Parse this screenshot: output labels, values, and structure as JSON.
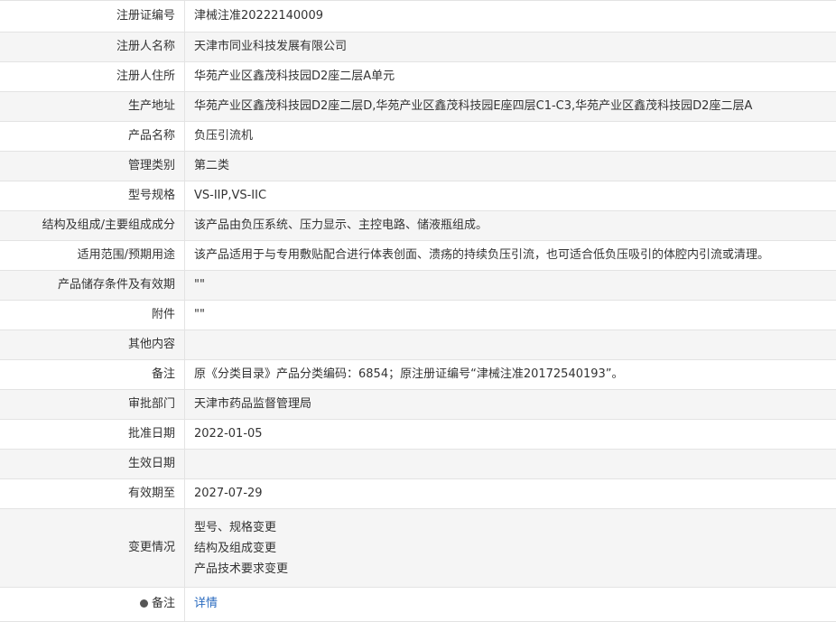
{
  "rows": [
    {
      "label": "注册证编号",
      "value": "津械注准20222140009"
    },
    {
      "label": "注册人名称",
      "value": "天津市同业科技发展有限公司"
    },
    {
      "label": "注册人住所",
      "value": "华苑产业区鑫茂科技园D2座二层A单元"
    },
    {
      "label": "生产地址",
      "value": "华苑产业区鑫茂科技园D2座二层D,华苑产业区鑫茂科技园E座四层C1-C3,华苑产业区鑫茂科技园D2座二层A"
    },
    {
      "label": "产品名称",
      "value": "负压引流机"
    },
    {
      "label": "管理类别",
      "value": "第二类"
    },
    {
      "label": "型号规格",
      "value": "VS-IIP,VS-IIC"
    },
    {
      "label": "结构及组成/主要组成成分",
      "value": "该产品由负压系统、压力显示、主控电路、储液瓶组成。"
    },
    {
      "label": "适用范围/预期用途",
      "value": "该产品适用于与专用敷贴配合进行体表创面、溃疡的持续负压引流，也可适合低负压吸引的体腔内引流或清理。"
    },
    {
      "label": "产品储存条件及有效期",
      "value": "\"\""
    },
    {
      "label": "附件",
      "value": "\"\""
    },
    {
      "label": "其他内容",
      "value": ""
    },
    {
      "label": "备注",
      "value": "原《分类目录》产品分类编码：6854；原注册证编号“津械注准20172540193”。"
    },
    {
      "label": "审批部门",
      "value": "天津市药品监督管理局"
    },
    {
      "label": "批准日期",
      "value": "2022-01-05"
    },
    {
      "label": "生效日期",
      "value": ""
    },
    {
      "label": "有效期至",
      "value": "2027-07-29"
    }
  ],
  "change": {
    "label": "变更情况",
    "items": [
      "型号、规格变更",
      "结构及组成变更",
      "产品技术要求变更"
    ]
  },
  "footer_row": {
    "label": "备注",
    "link_text": "详情"
  }
}
